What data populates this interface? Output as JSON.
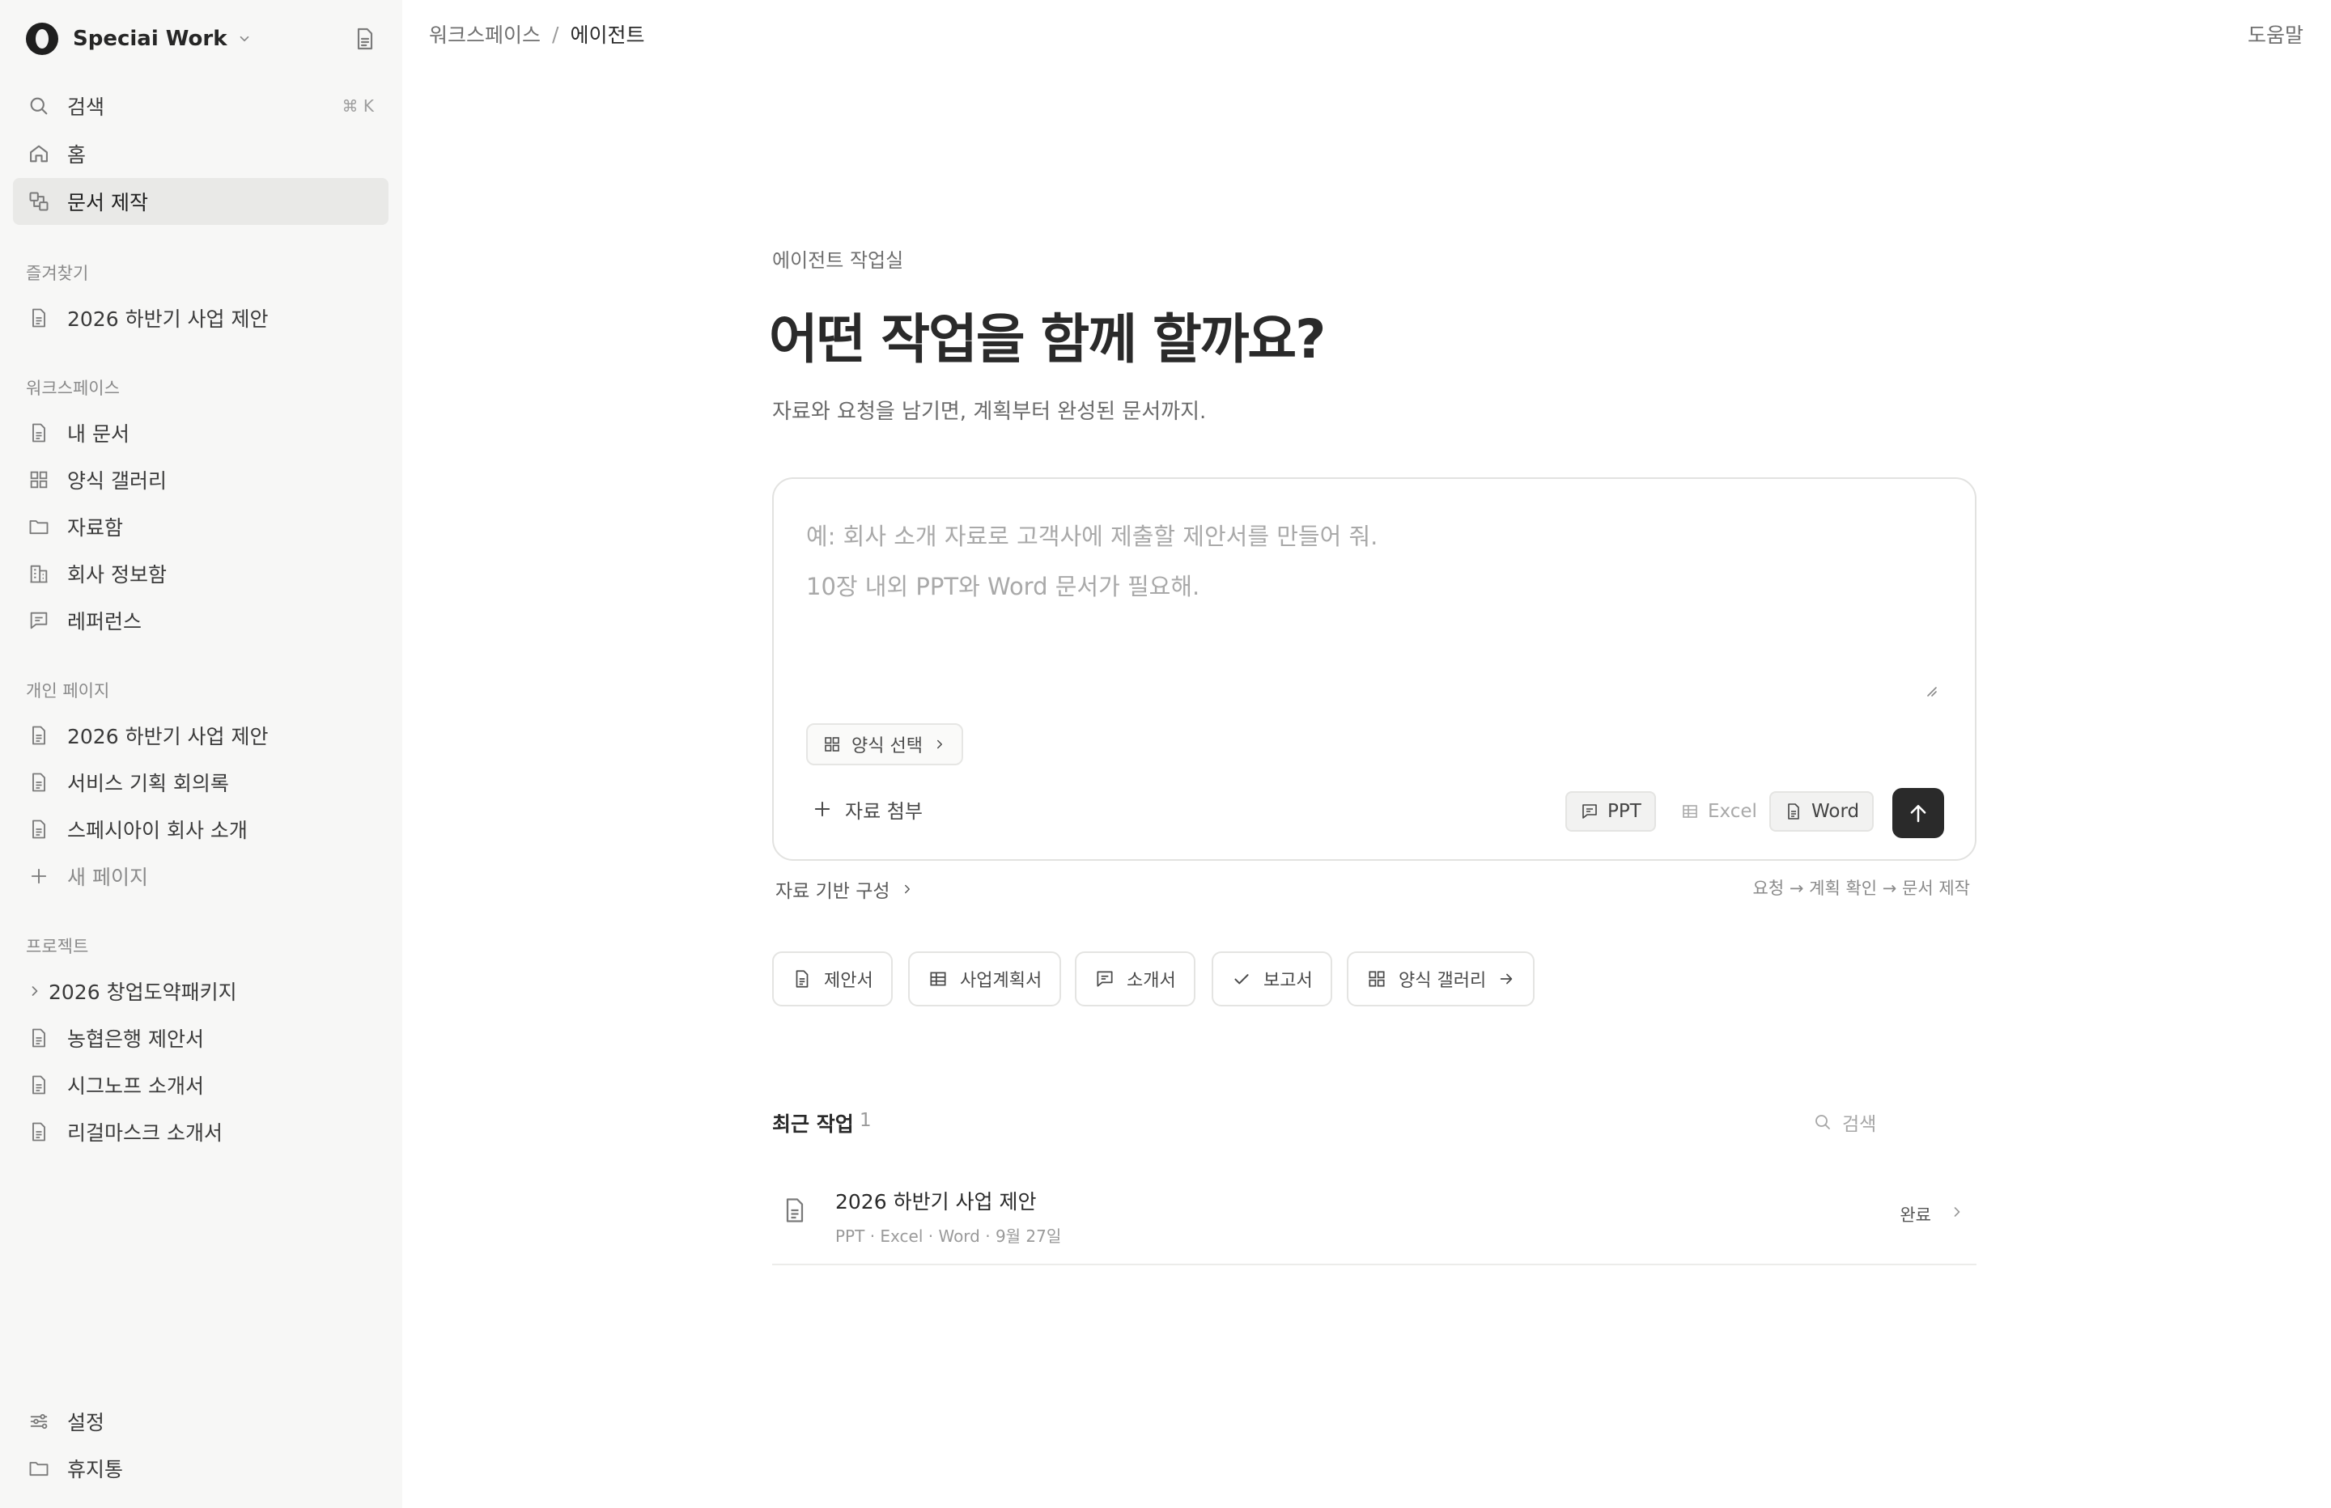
{
  "sidebar": {
    "workspace_name": "Speciai Work",
    "top_items": [
      {
        "label": "검색",
        "shortcut": "⌘ K"
      },
      {
        "label": "홈"
      },
      {
        "label": "문서 제작"
      }
    ],
    "favorites_label": "즐겨찾기",
    "favorites": [
      "2026 하반기 사업 제안"
    ],
    "workspace_label": "워크스페이스",
    "workspace_items": [
      "내 문서",
      "양식 갤러리",
      "자료함",
      "회사 정보함",
      "레퍼런스"
    ],
    "personal_label": "개인 페이지",
    "personal_items": [
      "2026 하반기 사업 제안",
      "서비스 기획 회의록",
      "스페시아이 회사 소개"
    ],
    "new_page": "새 페이지",
    "projects_label": "프로젝트",
    "project_group": "2026 창업도약패키지",
    "project_items": [
      "농협은행 제안서",
      "시그노프 소개서",
      "리걸마스크 소개서"
    ],
    "settings": "설정",
    "trash": "휴지통"
  },
  "topbar": {
    "breadcrumb": [
      "워크스페이스",
      "에이전트"
    ],
    "separator": "/",
    "help": "도움말"
  },
  "hero": {
    "eyebrow": "에이전트 작업실",
    "title": "어떤 작업을 함께 할까요?",
    "subtitle": "자료와 요청을 남기면, 계획부터 완성된 문서까지."
  },
  "composer": {
    "value": "",
    "placeholder": "예: 회사 소개 자료로 고객사에 제출할 제안서를 만들어 줘.\n10장 내외 PPT와 Word 문서가 필요해.",
    "template_label": "양식 선택",
    "attach_label": "자료 첨부",
    "formats": [
      {
        "label": "PPT",
        "selected": true
      },
      {
        "label": "Excel",
        "selected": false
      },
      {
        "label": "Word",
        "selected": true
      }
    ]
  },
  "basis": {
    "label": "자료 기반 구성",
    "flow": "요청 → 계획 확인 → 문서 제작"
  },
  "quick_actions": [
    "제안서",
    "사업계획서",
    "소개서",
    "보고서",
    "양식 갤러리"
  ],
  "recent": {
    "title": "최근 작업",
    "count": "1",
    "search_placeholder": "검색",
    "items": [
      {
        "title": "2026 하반기 사업 제안",
        "meta": "PPT · Excel · Word · 9월 27일",
        "status": "완료"
      }
    ]
  }
}
